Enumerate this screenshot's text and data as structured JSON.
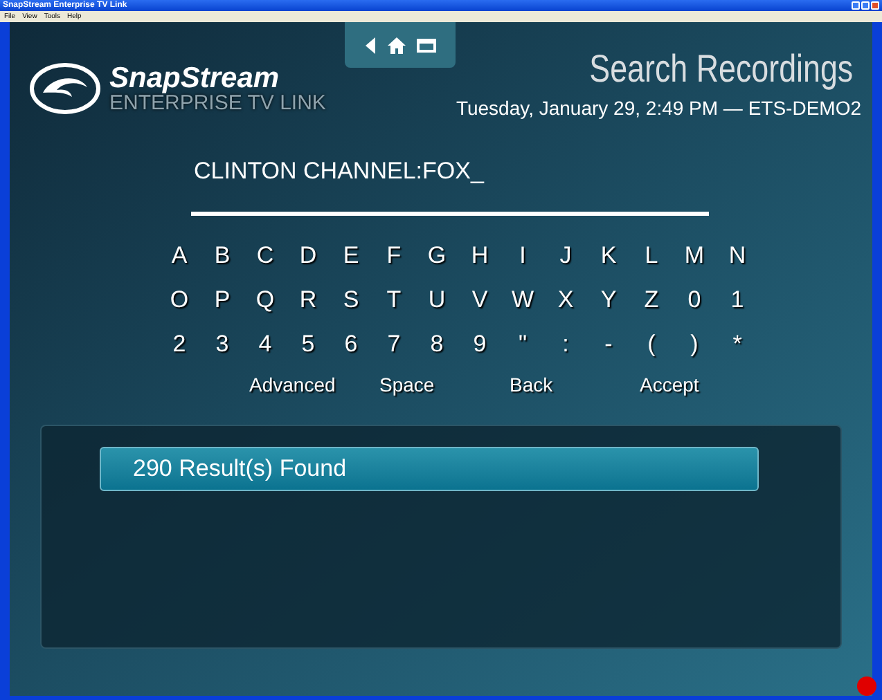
{
  "window": {
    "title": "SnapStream Enterprise TV Link"
  },
  "menu": [
    "File",
    "View",
    "Tools",
    "Help"
  ],
  "logo": {
    "brand": "SnapStream",
    "product": "ENTERPRISE TV LINK"
  },
  "nav": [
    {
      "kind": "back"
    },
    {
      "kind": "home"
    },
    {
      "kind": "window"
    }
  ],
  "page_title": "Search Recordings",
  "status_line": "Tuesday, January 29, 2:49 PM — ETS-DEMO2",
  "query": "CLINTON CHANNEL:FOX_",
  "keyboard": [
    [
      "A",
      "B",
      "C",
      "D",
      "E",
      "F",
      "G",
      "H",
      "I",
      "J",
      "K",
      "L",
      "M",
      "N"
    ],
    [
      "O",
      "P",
      "Q",
      "R",
      "S",
      "T",
      "U",
      "V",
      "W",
      "X",
      "Y",
      "Z",
      "0",
      "1"
    ],
    [
      "2",
      "3",
      "4",
      "5",
      "6",
      "7",
      "8",
      "9",
      "\"",
      ":",
      "-",
      "(",
      ")",
      "*"
    ]
  ],
  "actions": [
    "Advanced",
    "Space",
    "Back",
    "Accept"
  ],
  "results": [
    "290 Result(s) Found"
  ]
}
